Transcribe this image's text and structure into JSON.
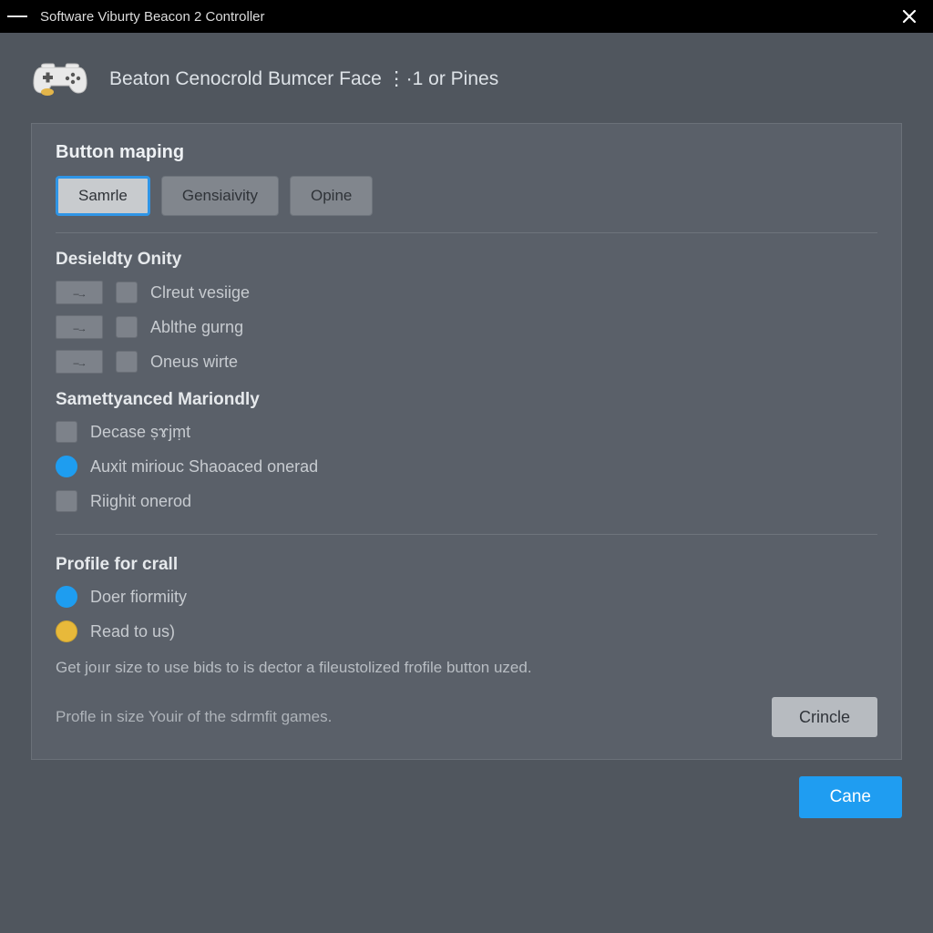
{
  "titlebar": {
    "title": "Software Viburty Beacon 2 Controller"
  },
  "header": {
    "heading": "Beaton Cenocrold Bumcer Face  ⋮·1 or Pines"
  },
  "panel": {
    "title": "Button maping",
    "tabs": [
      {
        "label": "Samrle",
        "active": true
      },
      {
        "label": "Gensiaivity",
        "active": false
      },
      {
        "label": "Opine",
        "active": false
      }
    ],
    "section1": {
      "title": "Desieldty Onity",
      "rows": [
        {
          "label": "Clreut vesiige"
        },
        {
          "label": "Ablthe gurng"
        },
        {
          "label": "Oneus wirte"
        }
      ]
    },
    "section2": {
      "title": "Samettyanced Mariondly",
      "rows": [
        {
          "kind": "checkbox",
          "label": "Decase ṣɤjṃt"
        },
        {
          "kind": "radio-blue",
          "label": "Auxit miriouc Shaoaced onerad"
        },
        {
          "kind": "checkbox",
          "label": "Riighit onerod"
        }
      ]
    },
    "section3": {
      "title": "Profile for crall",
      "rows": [
        {
          "kind": "radio-blue",
          "label": "Doer fiormiity"
        },
        {
          "kind": "radio-yellow",
          "label": "Read to us)"
        }
      ],
      "help": "Get joıır size to use bids to is dector a fileustolized frofile button uzed.",
      "note": "Profle in size Youir of the sdrmfit games.",
      "secondary_button": "Crincle"
    }
  },
  "footer": {
    "primary_button": "Cane"
  }
}
